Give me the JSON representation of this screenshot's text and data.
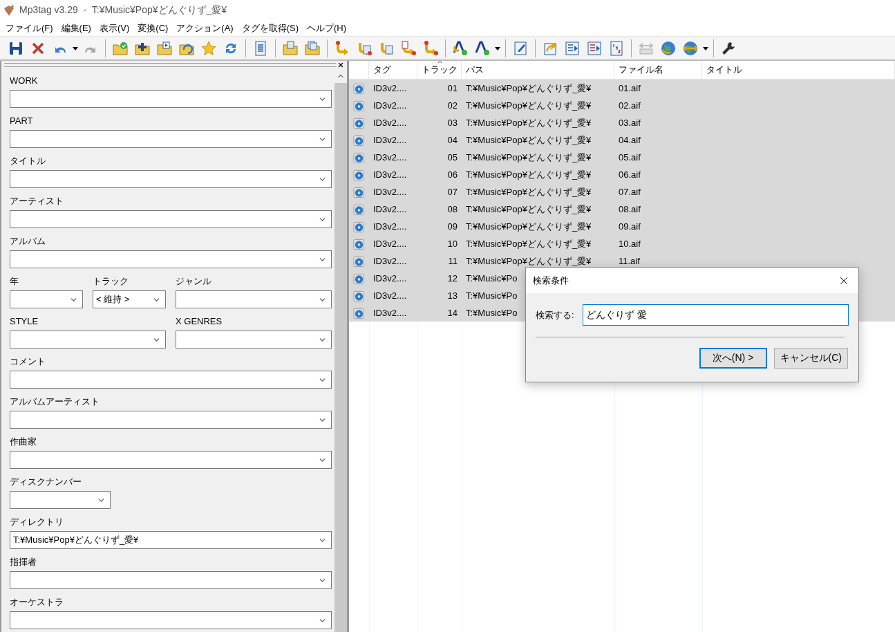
{
  "window": {
    "title": "Mp3tag v3.29  -  T:¥Music¥Pop¥どんぐりず_愛¥"
  },
  "menu": [
    "ファイル(F)",
    "編集(E)",
    "表示(V)",
    "変換(C)",
    "アクション(A)",
    "タグを取得(S)",
    "ヘルプ(H)"
  ],
  "tag_panel": {
    "rows": [
      {
        "fields": [
          {
            "label": "WORK",
            "kind": "full"
          }
        ]
      },
      {
        "fields": [
          {
            "label": "PART",
            "kind": "full"
          }
        ]
      },
      {
        "fields": [
          {
            "label": "タイトル",
            "kind": "full"
          }
        ]
      },
      {
        "fields": [
          {
            "label": "アーティスト",
            "kind": "full"
          }
        ]
      },
      {
        "fields": [
          {
            "label": "アルバム",
            "kind": "full"
          }
        ]
      },
      {
        "fields": [
          {
            "label": "年",
            "kind": "small"
          },
          {
            "label": "トラック",
            "kind": "small",
            "value": "< 維持 >"
          },
          {
            "label": "ジャンル",
            "kind": "half"
          }
        ]
      },
      {
        "fields": [
          {
            "label": "STYLE",
            "kind": "half"
          },
          {
            "label": "X GENRES",
            "kind": "half"
          }
        ]
      },
      {
        "fields": [
          {
            "label": "コメント",
            "kind": "full"
          }
        ]
      },
      {
        "fields": [
          {
            "label": "アルバムアーティスト",
            "kind": "full"
          }
        ]
      },
      {
        "fields": [
          {
            "label": "作曲家",
            "kind": "full"
          }
        ]
      },
      {
        "fields": [
          {
            "label": "ディスクナンバー",
            "kind": "medium"
          }
        ]
      },
      {
        "fields": [
          {
            "label": "ディレクトリ",
            "kind": "full",
            "value": "T:¥Music¥Pop¥どんぐりず_愛¥"
          }
        ]
      },
      {
        "fields": [
          {
            "label": "指揮者",
            "kind": "full"
          }
        ]
      },
      {
        "fields": [
          {
            "label": "オーケストラ",
            "kind": "full"
          }
        ]
      }
    ]
  },
  "file_list": {
    "columns": [
      "タグ",
      "トラック",
      "パス",
      "ファイル名",
      "タイトル"
    ],
    "rows": [
      {
        "tag": "ID3v2....",
        "track": "01",
        "path": "T:¥Music¥Pop¥どんぐりず_愛¥",
        "filename": "01.aif",
        "selected": true
      },
      {
        "tag": "ID3v2....",
        "track": "02",
        "path": "T:¥Music¥Pop¥どんぐりず_愛¥",
        "filename": "02.aif",
        "selected": true
      },
      {
        "tag": "ID3v2....",
        "track": "03",
        "path": "T:¥Music¥Pop¥どんぐりず_愛¥",
        "filename": "03.aif",
        "selected": true
      },
      {
        "tag": "ID3v2....",
        "track": "04",
        "path": "T:¥Music¥Pop¥どんぐりず_愛¥",
        "filename": "04.aif",
        "selected": true
      },
      {
        "tag": "ID3v2....",
        "track": "05",
        "path": "T:¥Music¥Pop¥どんぐりず_愛¥",
        "filename": "05.aif",
        "selected": true
      },
      {
        "tag": "ID3v2....",
        "track": "06",
        "path": "T:¥Music¥Pop¥どんぐりず_愛¥",
        "filename": "06.aif",
        "selected": true
      },
      {
        "tag": "ID3v2....",
        "track": "07",
        "path": "T:¥Music¥Pop¥どんぐりず_愛¥",
        "filename": "07.aif",
        "selected": true
      },
      {
        "tag": "ID3v2....",
        "track": "08",
        "path": "T:¥Music¥Pop¥どんぐりず_愛¥",
        "filename": "08.aif",
        "selected": true
      },
      {
        "tag": "ID3v2....",
        "track": "09",
        "path": "T:¥Music¥Pop¥どんぐりず_愛¥",
        "filename": "09.aif",
        "selected": true
      },
      {
        "tag": "ID3v2....",
        "track": "10",
        "path": "T:¥Music¥Pop¥どんぐりず_愛¥",
        "filename": "10.aif",
        "selected": true
      },
      {
        "tag": "ID3v2....",
        "track": "11",
        "path": "T:¥Music¥Pop¥どんぐりず_愛¥",
        "filename": "11.aif",
        "selected": true
      },
      {
        "tag": "ID3v2....",
        "track": "12",
        "path": "T:¥Music¥Po",
        "selected": true
      },
      {
        "tag": "ID3v2....",
        "track": "13",
        "path": "T:¥Music¥Po",
        "selected": true
      },
      {
        "tag": "ID3v2....",
        "track": "14",
        "path": "T:¥Music¥Po",
        "selected": true
      }
    ]
  },
  "find_dialog": {
    "title": "検索条件",
    "label": "検索する:",
    "value": "どんぐりず 愛",
    "buttons": [
      {
        "label": "次へ(N) >",
        "default": true
      },
      {
        "label": "キャンセル(C)",
        "default": false
      }
    ]
  }
}
